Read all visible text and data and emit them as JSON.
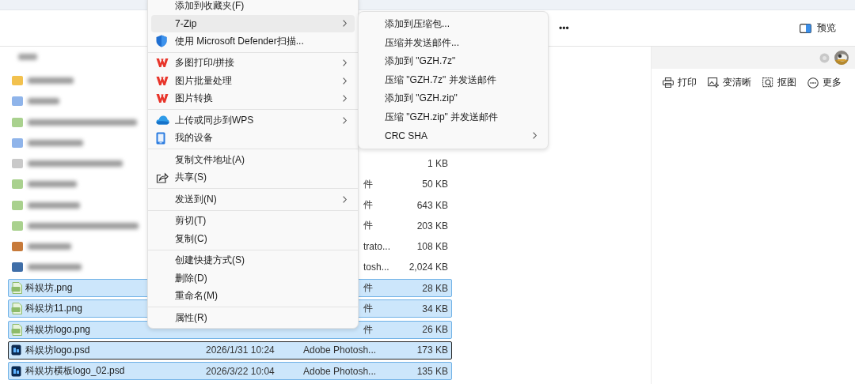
{
  "toolbar": {
    "more": "•••",
    "preview": "预览"
  },
  "files": [
    {
      "kind": "blurred",
      "color": "#f2c14e",
      "selected": false,
      "focused": false
    },
    {
      "kind": "blurred",
      "color": "#8fb4ea",
      "selected": false,
      "focused": false
    },
    {
      "kind": "blurred",
      "color": "#a9d18e",
      "selected": false,
      "focused": false
    },
    {
      "kind": "blurred",
      "color": "#8fb4ea",
      "selected": false,
      "focused": false
    },
    {
      "kind": "blurred",
      "color": "#c9c9c9",
      "size": "1 KB",
      "selected": false,
      "focused": false
    },
    {
      "kind": "blurred",
      "color": "#a9d18e",
      "type": "件",
      "size": "50 KB",
      "selected": false,
      "focused": false
    },
    {
      "kind": "blurred",
      "color": "#a9d18e",
      "type": "件",
      "size": "643 KB",
      "selected": false,
      "focused": false
    },
    {
      "kind": "blurred",
      "color": "#a9d18e",
      "type": "件",
      "size": "203 KB",
      "selected": false,
      "focused": false
    },
    {
      "kind": "blurred",
      "color": "#c77a3a",
      "type": "trato...",
      "size": "108 KB",
      "selected": false,
      "focused": false
    },
    {
      "kind": "blurred",
      "color": "#3f6ea8",
      "type": "tosh...",
      "size": "2,024 KB",
      "selected": false,
      "focused": false
    },
    {
      "kind": "png",
      "name": "科娱坊.png",
      "type": "件",
      "size": "28 KB",
      "selected": true,
      "focused": false
    },
    {
      "kind": "png",
      "name": "科娱坊11.png",
      "type": "件",
      "size": "34 KB",
      "selected": true,
      "focused": false
    },
    {
      "kind": "png",
      "name": "科娱坊logo.png",
      "type": "件",
      "size": "26 KB",
      "selected": true,
      "focused": false
    },
    {
      "kind": "psd",
      "name": "科娱坊logo.psd",
      "date": "2026/1/31 10:24",
      "type": "Adobe Photosh...",
      "size": "173 KB",
      "selected": true,
      "focused": true
    },
    {
      "kind": "psd",
      "name": "科娱坊横板logo_02.psd",
      "date": "2026/3/22 10:04",
      "type": "Adobe Photosh...",
      "size": "135 KB",
      "selected": true,
      "focused": false
    }
  ],
  "context_menu": [
    {
      "kind": "item",
      "label": "添加到收藏夹(F)",
      "submenu": false,
      "selected": false
    },
    {
      "kind": "item",
      "label": "7-Zip",
      "submenu": true,
      "selected": true
    },
    {
      "kind": "item",
      "label": "使用 Microsoft Defender扫描...",
      "submenu": false,
      "selected": false
    },
    {
      "kind": "separator"
    },
    {
      "kind": "item",
      "label": "多图打印/拼接",
      "submenu": true,
      "selected": false
    },
    {
      "kind": "item",
      "label": "图片批量处理",
      "submenu": true,
      "selected": false
    },
    {
      "kind": "item",
      "label": "图片转换",
      "submenu": true,
      "selected": false
    },
    {
      "kind": "separator"
    },
    {
      "kind": "item",
      "label": "上传或同步到WPS",
      "submenu": true,
      "selected": false
    },
    {
      "kind": "item",
      "label": "我的设备",
      "submenu": false,
      "selected": false
    },
    {
      "kind": "separator"
    },
    {
      "kind": "item",
      "label": "复制文件地址(A)",
      "submenu": false,
      "selected": false
    },
    {
      "kind": "item",
      "label": "共享(S)",
      "submenu": false,
      "selected": false
    },
    {
      "kind": "separator"
    },
    {
      "kind": "item",
      "label": "发送到(N)",
      "submenu": true,
      "selected": false
    },
    {
      "kind": "separator"
    },
    {
      "kind": "item",
      "label": "剪切(T)",
      "submenu": false,
      "selected": false
    },
    {
      "kind": "item",
      "label": "复制(C)",
      "submenu": false,
      "selected": false
    },
    {
      "kind": "separator"
    },
    {
      "kind": "item",
      "label": "创建快捷方式(S)",
      "submenu": false,
      "selected": false
    },
    {
      "kind": "item",
      "label": "删除(D)",
      "submenu": false,
      "selected": false
    },
    {
      "kind": "item",
      "label": "重命名(M)",
      "submenu": false,
      "selected": false
    },
    {
      "kind": "separator"
    },
    {
      "kind": "item",
      "label": "属性(R)",
      "submenu": false,
      "selected": false
    }
  ],
  "submenu": [
    {
      "kind": "item",
      "label": "添加到压缩包...",
      "submenu": false,
      "selected": false
    },
    {
      "kind": "item",
      "label": "压缩并发送邮件...",
      "submenu": false,
      "selected": false
    },
    {
      "kind": "item",
      "label": "添加到 \"GZH.7z\"",
      "submenu": false,
      "selected": false
    },
    {
      "kind": "item",
      "label": "压缩 \"GZH.7z\" 并发送邮件",
      "submenu": false,
      "selected": false
    },
    {
      "kind": "item",
      "label": "添加到 \"GZH.zip\"",
      "submenu": false,
      "selected": false
    },
    {
      "kind": "item",
      "label": "压缩 \"GZH.zip\" 并发送邮件",
      "submenu": false,
      "selected": false
    },
    {
      "kind": "item",
      "label": "CRC SHA",
      "submenu": true,
      "selected": false
    }
  ],
  "preview_pane": {
    "actions": [
      {
        "label": "打印"
      },
      {
        "label": "变清晰"
      },
      {
        "label": "抠图"
      },
      {
        "label": "更多"
      }
    ]
  }
}
